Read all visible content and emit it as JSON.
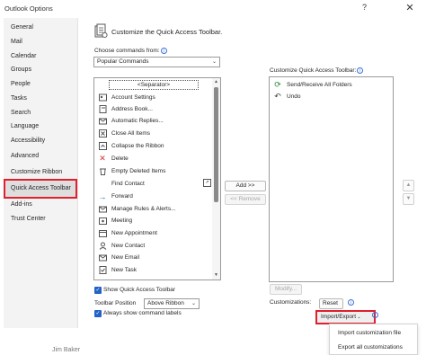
{
  "window": {
    "title": "Outlook Options",
    "help_label": "?",
    "close_label": "✕"
  },
  "sidebar": {
    "items": [
      {
        "label": "General"
      },
      {
        "label": "Mail"
      },
      {
        "label": "Calendar"
      },
      {
        "label": "Groups"
      },
      {
        "label": "People"
      },
      {
        "label": "Tasks"
      },
      {
        "label": "Search"
      },
      {
        "label": "Language"
      },
      {
        "label": "Accessibility"
      },
      {
        "label": "Advanced"
      },
      {
        "label": "Customize Ribbon"
      },
      {
        "label": "Quick Access Toolbar"
      },
      {
        "label": "Add-ins"
      },
      {
        "label": "Trust Center"
      }
    ],
    "selected": "Quick Access Toolbar"
  },
  "main": {
    "heading": "Customize the Quick Access Toolbar.",
    "choose_commands_label": "Choose commands from:",
    "choose_commands_value": "Popular Commands",
    "commands": [
      {
        "label": "Account Settings",
        "icon": "account-settings-icon"
      },
      {
        "label": "Address Book...",
        "icon": "address-book-icon"
      },
      {
        "label": "Automatic Replies...",
        "icon": "automatic-replies-icon"
      },
      {
        "label": "Close All Items",
        "icon": "close-all-icon"
      },
      {
        "label": "Collapse the Ribbon",
        "icon": "collapse-ribbon-icon"
      },
      {
        "label": "Delete",
        "icon": "delete-icon"
      },
      {
        "label": "Empty Deleted Items",
        "icon": "empty-deleted-icon"
      },
      {
        "label": "Find Contact",
        "icon": "find-contact-icon"
      },
      {
        "label": "Forward",
        "icon": "forward-icon"
      },
      {
        "label": "Manage Rules & Alerts...",
        "icon": "rules-icon"
      },
      {
        "label": "Meeting",
        "icon": "meeting-icon"
      },
      {
        "label": "New Appointment",
        "icon": "new-appointment-icon"
      },
      {
        "label": "New Contact",
        "icon": "new-contact-icon"
      },
      {
        "label": "New Email",
        "icon": "new-email-icon"
      },
      {
        "label": "New Task",
        "icon": "new-task-icon"
      }
    ],
    "separator_label": "<Separator>",
    "add_button": "Add >>",
    "remove_button": "<< Remove",
    "qat_label": "Customize Quick Access Toolbar:",
    "qat_items": [
      {
        "label": "Send/Receive All Folders",
        "icon": "send-receive-icon"
      },
      {
        "label": "Undo",
        "icon": "undo-icon"
      }
    ],
    "move_up": "▲",
    "move_down": "▼",
    "modify_button": "Modify...",
    "show_qat_label": "Show Quick Access Toolbar",
    "toolbar_position_label": "Toolbar Position",
    "toolbar_position_value": "Above Ribbon",
    "always_show_labels": "Always show command labels",
    "customizations_label": "Customizations:",
    "reset_button": "Reset",
    "import_export_button": "Import/Export",
    "import_export_menu": [
      "Import customization file",
      "Export all customizations"
    ]
  },
  "footer": {
    "user_name": "Jim Baker"
  },
  "colors": {
    "accent": "#2462c8",
    "highlight": "#e0202c"
  }
}
